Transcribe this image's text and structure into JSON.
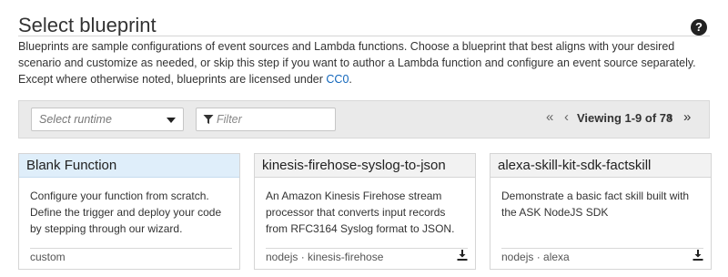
{
  "header": {
    "title": "Select blueprint",
    "help_icon": "?",
    "description": "Blueprints are sample configurations of event sources and Lambda functions. Choose a blueprint that best aligns with your desired scenario and customize as needed, or skip this step if you want to author a Lambda function and configure an event source separately. Except where otherwise noted, blueprints are licensed under ",
    "license_link": "CC0",
    "description_end": "."
  },
  "toolbar": {
    "runtime_placeholder": "Select runtime",
    "filter_placeholder": "Filter",
    "first_icon": "«",
    "prev_icon": "‹",
    "viewing": "Viewing 1-9 of 78",
    "next_icon": "›",
    "last_icon": "»"
  },
  "cards": [
    {
      "title": "Blank Function",
      "description": "Configure your function from scratch. Define the trigger and deploy your code by stepping through our wizard.",
      "tags": "custom",
      "download": false
    },
    {
      "title": "kinesis-firehose-syslog-to-json",
      "description": "An Amazon Kinesis Firehose stream processor that converts input records from RFC3164 Syslog format to JSON.",
      "tags": "nodejs · kinesis-firehose",
      "download": true
    },
    {
      "title": "alexa-skill-kit-sdk-factskill",
      "description": "Demonstrate a basic fact skill built with the ASK NodeJS SDK",
      "tags": "nodejs · alexa",
      "download": true
    }
  ],
  "colors": {
    "link": "#1166bb",
    "selected_header": "#dfeefa"
  }
}
